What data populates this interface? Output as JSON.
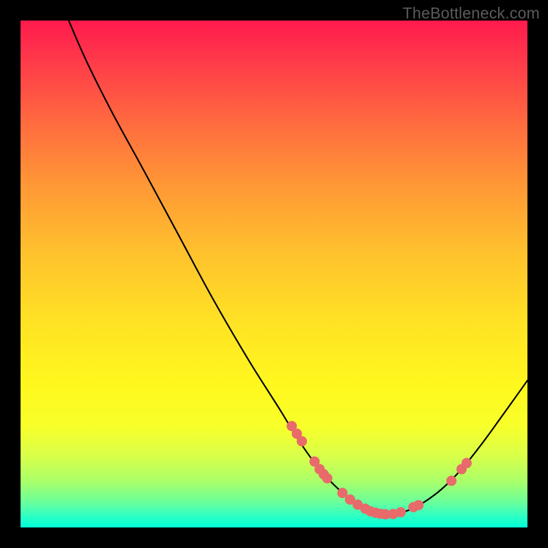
{
  "watermark": "TheBottleneck.com",
  "chart_data": {
    "type": "line",
    "title": "",
    "xlabel": "",
    "ylabel": "",
    "xlim": [
      0,
      100
    ],
    "ylim": [
      0,
      100
    ],
    "grid": false,
    "annotations": [],
    "curve": [
      {
        "x": 9.5,
        "y": 100
      },
      {
        "x": 13,
        "y": 92
      },
      {
        "x": 18,
        "y": 82
      },
      {
        "x": 24,
        "y": 71
      },
      {
        "x": 31,
        "y": 58
      },
      {
        "x": 38,
        "y": 45
      },
      {
        "x": 45,
        "y": 33
      },
      {
        "x": 51,
        "y": 23.5
      },
      {
        "x": 55,
        "y": 17
      },
      {
        "x": 59,
        "y": 11.5
      },
      {
        "x": 63,
        "y": 7.3
      },
      {
        "x": 67,
        "y": 4.3
      },
      {
        "x": 70,
        "y": 2.9
      },
      {
        "x": 73,
        "y": 2.6
      },
      {
        "x": 76,
        "y": 3.2
      },
      {
        "x": 79,
        "y": 4.6
      },
      {
        "x": 83,
        "y": 7.5
      },
      {
        "x": 87,
        "y": 11.5
      },
      {
        "x": 91,
        "y": 16.5
      },
      {
        "x": 95,
        "y": 22
      },
      {
        "x": 100,
        "y": 29
      }
    ],
    "series": [
      {
        "name": "markers",
        "points": [
          {
            "x": 53.5,
            "y": 20
          },
          {
            "x": 54.5,
            "y": 18.5
          },
          {
            "x": 55.5,
            "y": 17
          },
          {
            "x": 58,
            "y": 13
          },
          {
            "x": 59,
            "y": 11.5
          },
          {
            "x": 59.8,
            "y": 10.5
          },
          {
            "x": 60.5,
            "y": 9.7
          },
          {
            "x": 63.5,
            "y": 6.8
          },
          {
            "x": 65,
            "y": 5.5
          },
          {
            "x": 66.5,
            "y": 4.5
          },
          {
            "x": 68,
            "y": 3.7
          },
          {
            "x": 69,
            "y": 3.2
          },
          {
            "x": 70,
            "y": 2.9
          },
          {
            "x": 71,
            "y": 2.7
          },
          {
            "x": 72,
            "y": 2.6
          },
          {
            "x": 73.5,
            "y": 2.65
          },
          {
            "x": 75,
            "y": 3
          },
          {
            "x": 77.5,
            "y": 4
          },
          {
            "x": 78.5,
            "y": 4.4
          },
          {
            "x": 85,
            "y": 9.2
          },
          {
            "x": 87,
            "y": 11.5
          },
          {
            "x": 88,
            "y": 12.7
          }
        ]
      }
    ]
  }
}
